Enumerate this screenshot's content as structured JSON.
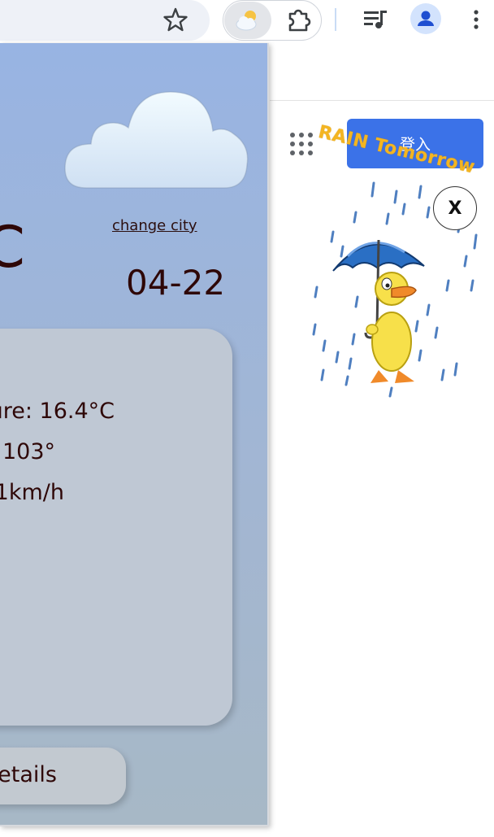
{
  "toolbar": {
    "star_icon": "star-icon",
    "weather_ext_icon": "cloud-sun-icon",
    "extensions_icon": "puzzle-icon",
    "media_icon": "media-queue-icon",
    "profile_icon": "person-icon",
    "menu_icon": "kebab-menu-icon"
  },
  "page": {
    "signin_label": "登入",
    "apps_icon": "apps-grid-icon"
  },
  "overlay": {
    "rain_text": "RAIN Tomorrow",
    "close_label": "X",
    "character": "duck-with-umbrella-in-rain"
  },
  "weather": {
    "change_city": "change city",
    "temp_fragment": "C",
    "date": "04-22",
    "lines": [
      "ture: 16.4°C",
      ": 103°",
      "1km/h"
    ],
    "details_label": "etails"
  },
  "colors": {
    "popup_top": "#98b4e3",
    "popup_bottom": "#a7b8c6",
    "card": "#bfc8d4",
    "text": "#2e0707",
    "signin": "#3b72e8",
    "rain_text": "#f4b521"
  }
}
